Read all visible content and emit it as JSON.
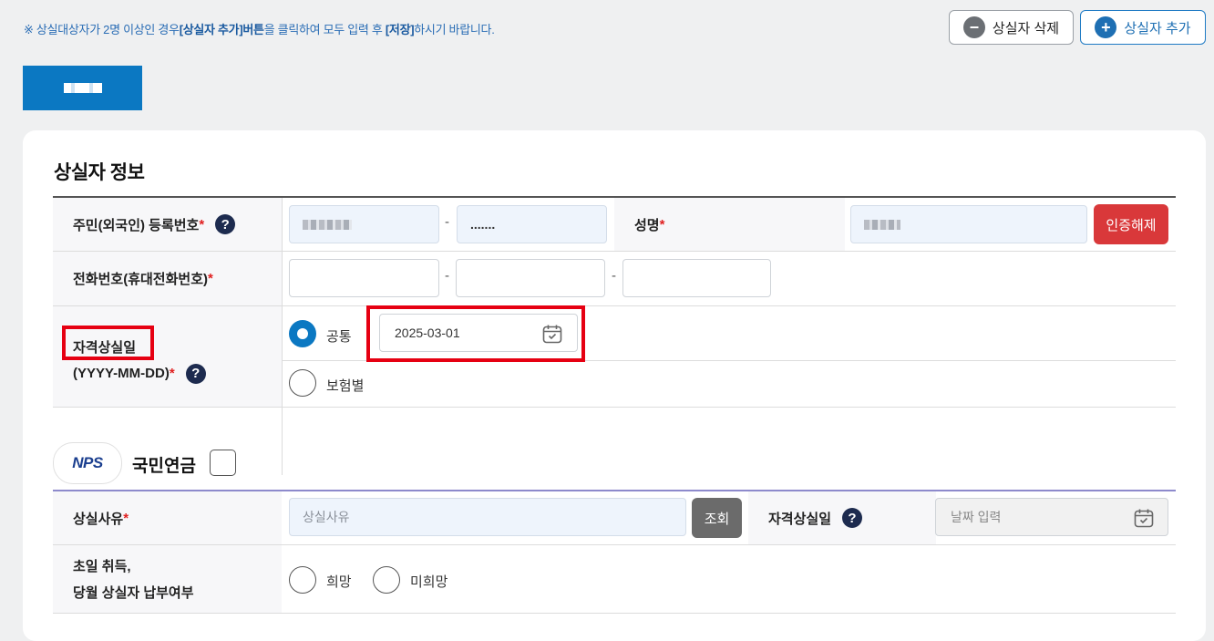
{
  "notice": {
    "prefix": "※ 상실대상자가 2명 이상인 경우",
    "bold1": "[상실자 추가]버튼",
    "middle": "을 클릭하여 모두 입력 후 ",
    "bold2": "[저장]",
    "suffix": "하시기 바랍니다."
  },
  "top_buttons": {
    "delete_label": "상실자 삭제",
    "add_label": "상실자 추가"
  },
  "person_info": {
    "title": "상실자 정보",
    "rrn_label": "주민(외국인) 등록번호",
    "rrn_second_value": ".......",
    "name_label": "성명",
    "cert_release_label": "인증해제",
    "phone_label": "전화번호(휴대전화번호)",
    "loss_date_label": "자격상실일",
    "loss_date_format": "(YYYY-MM-DD)",
    "option_common": "공통",
    "option_by_insurance": "보험별",
    "loss_date_value": "2025-03-01",
    "required_mark": "*",
    "help_icon": "?"
  },
  "nps": {
    "logo_text": "NPS",
    "title": "국민연금",
    "loss_reason_label": "상실사유",
    "loss_reason_placeholder": "상실사유",
    "lookup_label": "조회",
    "loss_date_label": "자격상실일",
    "loss_date_placeholder": "날짜 입력",
    "first_day_label_1": "초일 취득,",
    "first_day_label_2": "당월 상실자 납부여부",
    "option_want": "희망",
    "option_not_want": "미희망"
  },
  "colors": {
    "accent": "#0b78c2",
    "danger": "#d9383a",
    "highlight_box": "#e60012"
  }
}
